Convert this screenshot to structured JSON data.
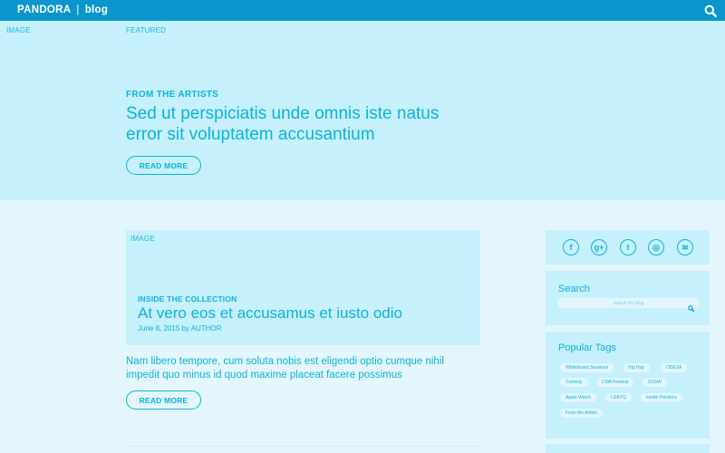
{
  "header": {
    "brand": "PANDORA",
    "separator": "|",
    "section": "blog"
  },
  "hero": {
    "image_label": "IMAGE",
    "featured_label": "FEATURED",
    "kicker": "FROM THE ARTISTS",
    "title": "Sed ut perspiciatis unde omnis iste natus error sit voluptatem accusantium",
    "button": "READ MORE"
  },
  "post": {
    "image_label": "IMAGE",
    "kicker": "INSIDE THE COLLECTION",
    "title": "At vero eos et accusamus et iusto odio",
    "meta": "June 8, 2015 by AUTHOR",
    "excerpt": "Nam libero tempore, cum soluta nobis est eligendi optio cumque nihil impedit quo minus id quod maxime placeat facere possimus",
    "button": "READ MORE"
  },
  "sidebar": {
    "social": [
      {
        "icon": "facebook-icon",
        "glyph": "f"
      },
      {
        "icon": "google-plus-icon",
        "glyph": "g+"
      },
      {
        "icon": "twitter-icon",
        "glyph": "t"
      },
      {
        "icon": "instagram-icon",
        "glyph": "◎"
      },
      {
        "icon": "rss-icon",
        "glyph": "≋"
      }
    ],
    "search": {
      "title": "Search",
      "placeholder": "search the blog"
    },
    "tags": {
      "title": "Popular Tags",
      "items": [
        "Whiteboard Sessions",
        "Hip Hop",
        "ODEZA",
        "Comedy",
        "CMA Festival",
        "SXSW",
        "Apple Watch",
        "LGBTQ",
        "Inside Pandora",
        "From the Artists"
      ]
    }
  },
  "colors": {
    "header": "#0a96cc",
    "accent": "#0fb3d6",
    "panel": "#c5f0fc",
    "background": "#e3f6fd"
  }
}
